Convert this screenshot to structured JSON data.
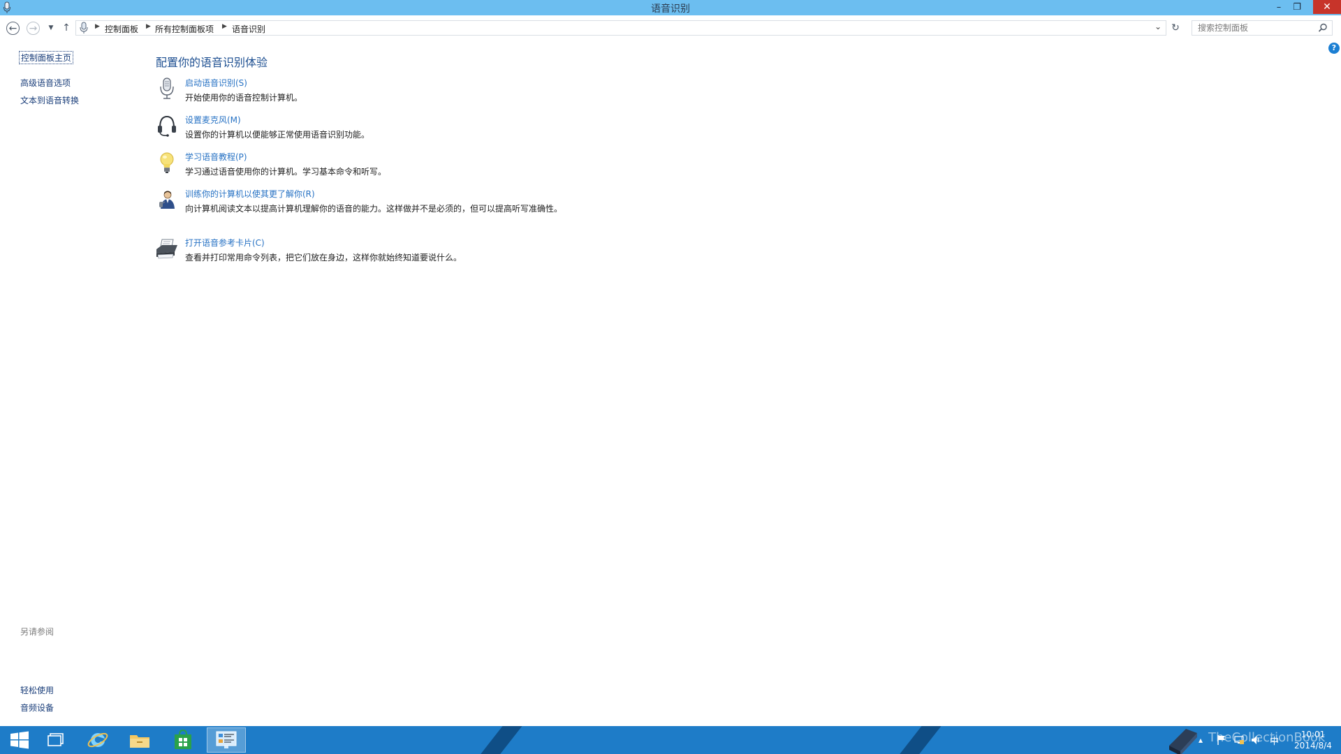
{
  "window": {
    "title": "语音识别",
    "minimize_glyph": "–",
    "maximize_glyph": "❐",
    "close_glyph": "✕"
  },
  "nav": {
    "breadcrumbs": [
      "控制面板",
      "所有控制面板项",
      "语音识别"
    ],
    "search_placeholder": "搜索控制面板"
  },
  "help_glyph": "?",
  "left_pane": {
    "home": "控制面板主页",
    "links": [
      "高级语音选项",
      "文本到语音转换"
    ],
    "see_also_title": "另请参阅",
    "see_also": [
      "轻松使用",
      "音频设备"
    ]
  },
  "main": {
    "title": "配置你的语音识别体验",
    "tasks": [
      {
        "label": "启动语音识别(S)",
        "desc": "开始使用你的语音控制计算机。",
        "icon": "microphone-icon"
      },
      {
        "label": "设置麦克风(M)",
        "desc": "设置你的计算机以便能够正常使用语音识别功能。",
        "icon": "headset-icon"
      },
      {
        "label": "学习语音教程(P)",
        "desc": "学习通过语音使用你的计算机。学习基本命令和听写。",
        "icon": "lightbulb-icon"
      },
      {
        "label": "训练你的计算机以使其更了解你(R)",
        "desc": "向计算机阅读文本以提高计算机理解你的语音的能力。这样做并不是必须的，但可以提高听写准确性。",
        "icon": "user-icon"
      },
      {
        "label": "打开语音参考卡片(C)",
        "desc": "查看并打印常用命令列表，把它们放在身边，这样你就始终知道要说什么。",
        "icon": "printer-icon"
      }
    ]
  },
  "taskbar": {
    "apps": [
      "start-icon",
      "file-manager-icon",
      "internet-explorer-icon",
      "folder-icon",
      "store-icon",
      "control-panel-icon"
    ],
    "ime": "中",
    "clock_time": "10:01",
    "clock_date": "2014/8/4",
    "watermark": "TheCollectionBook"
  },
  "colors": {
    "titlebar": "#6cbef0",
    "taskbar": "#1e7cc8",
    "link": "#2772c4",
    "heading": "#1d4f91",
    "close": "#c7342a"
  }
}
